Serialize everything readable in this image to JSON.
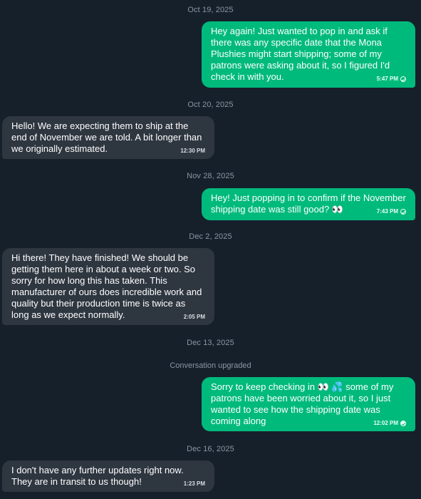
{
  "conversation": {
    "system_note": "Conversation upgraded",
    "dates": {
      "d1": "Oct 19, 2025",
      "d2": "Oct 20, 2025",
      "d3": "Nov 28, 2025",
      "d4": "Dec 2, 2025",
      "d5": "Dec 13, 2025",
      "d6": "Dec 16, 2025"
    },
    "messages": [
      {
        "direction": "sent",
        "text": "Hey again! Just wanted to pop in and ask if there was any specific date that the Mona Plushies might start shipping; some of my patrons were asking about it, so I figured I'd check in with you.",
        "time": "5:47 PM",
        "status": "sent"
      },
      {
        "direction": "received",
        "text": "Hello! We are expecting them to ship at the end of November we are told. A bit longer than we originally estimated.",
        "time": "12:30 PM"
      },
      {
        "direction": "sent",
        "text": "Hey! Just popping in to confirm if the November shipping date was still good? 👀",
        "time": "7:43 PM",
        "status": "sent"
      },
      {
        "direction": "received",
        "text": "Hi there! They have finished! We should be getting them here in about a week or two. So sorry for how long this has taken. This manufacturer of ours does incredible work and quality but their production time is twice as long as we expect normally.",
        "time": "2:05 PM"
      },
      {
        "direction": "sent",
        "text": "Sorry to keep checking in 👀 💦 some of my patrons have been worried about it, so I just wanted to see how the shipping date was coming along",
        "time": "12:02 PM",
        "status": "read"
      },
      {
        "direction": "received",
        "text": "I don't have any further updates right now. They are in transit to us though!",
        "time": "1:23 PM"
      }
    ]
  }
}
